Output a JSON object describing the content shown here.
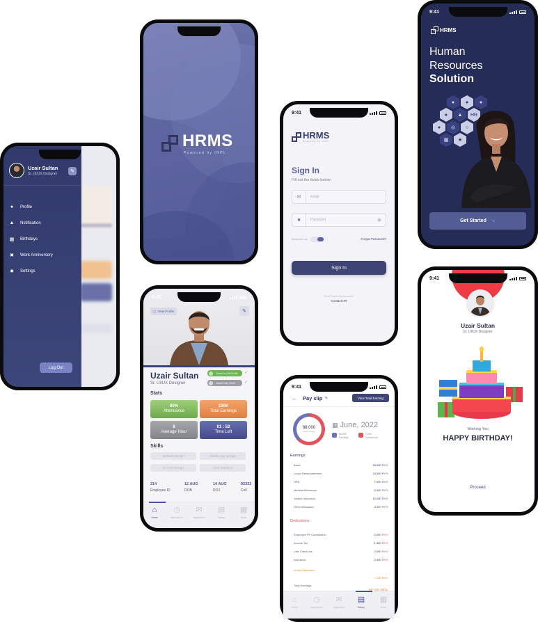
{
  "status_time": "9:41",
  "brand": {
    "name": "HRMS",
    "tagline": "Powered by INPL"
  },
  "user": {
    "name": "Uzair Sultan",
    "role": "Sr. UI/UX Designer"
  },
  "side_menu": {
    "items": [
      {
        "icon": "user-icon",
        "label": "Profile"
      },
      {
        "icon": "bell-icon",
        "label": "Notification"
      },
      {
        "icon": "calendar-icon",
        "label": "Birthdays"
      },
      {
        "icon": "anniversary-icon",
        "label": "Work Anniversery"
      },
      {
        "icon": "gear-icon",
        "label": "Settings"
      }
    ],
    "logout_label": "Log Out"
  },
  "signin": {
    "title": "Sign In",
    "subtitle": "Fill out the fields below:",
    "email_placeholder": "Email",
    "password_placeholder": "Password",
    "remember_label": "Remember me",
    "forgot_label": "Forgot Password?",
    "button_label": "Sign In",
    "no_account_text": "Don't Have An Account?",
    "contact_label": "Contact HR"
  },
  "profile": {
    "view_profile_label": "View Profile",
    "check_in": "Check In  |  09:00 AM",
    "check_out": "Check Out  |  06:00",
    "stats_heading": "Stats",
    "stats": [
      {
        "value": "80%",
        "label": "Attendance",
        "color": "#7fb85a"
      },
      {
        "value": "100K",
        "label": "Total Earnings",
        "color": "#e88a4c"
      },
      {
        "value": "8",
        "label": "Average Hour",
        "color": "#8e8e96"
      },
      {
        "value": "01 : 52",
        "label": "Time Left",
        "color": "#4d5596"
      }
    ],
    "skills_heading": "Skills",
    "skills": [
      "Website Design",
      "Mobile App Design",
      "UI / UX Design",
      "User Interface"
    ],
    "info": [
      {
        "value": "214",
        "label": "Employee ID"
      },
      {
        "value": "12 AUG",
        "label": "DOB"
      },
      {
        "value": "14 AUG",
        "label": "DOJ"
      },
      {
        "value": "92333",
        "label": "Cell"
      }
    ]
  },
  "tabs": [
    {
      "icon": "home-icon",
      "label": "Home"
    },
    {
      "icon": "clock-icon",
      "label": "Attendance"
    },
    {
      "icon": "mail-icon",
      "label": "Application"
    },
    {
      "icon": "document-icon",
      "label": "Salary"
    },
    {
      "icon": "grid-icon",
      "label": "More"
    }
  ],
  "payslip": {
    "title": "Pay slip",
    "view_total_label": "View Total Earning",
    "donut_value": "88,000",
    "donut_label": "Gross Salary",
    "date": "June, 2022",
    "legend": [
      {
        "value": "88,000",
        "label": "Earnings",
        "color": "#6b72b8"
      },
      {
        "value": "7,000",
        "label": "Deductions",
        "color": "#e2545d"
      }
    ],
    "earnings_heading": "Earnings",
    "earnings": [
      {
        "label": "Basic",
        "amount": "35,000",
        "currency": "PKR"
      },
      {
        "label": "Lunch Reimbursement",
        "amount": "23,000",
        "currency": "PKR"
      },
      {
        "label": "HRA",
        "amount": "7,000",
        "currency": "PKR"
      },
      {
        "label": "Medical Allowance",
        "amount": "5,000",
        "currency": "PKR"
      },
      {
        "label": "Jubilee Insurance",
        "amount": "10,000",
        "currency": "PKR"
      },
      {
        "label": "Other Allowance",
        "amount": "3,000",
        "currency": "PKR"
      }
    ],
    "deductions_heading": "Deductions",
    "deductions": [
      {
        "label": "Employee PF Contribution",
        "amount": "2,000",
        "currency": "PKR"
      },
      {
        "label": "Income Tax",
        "amount": "1,000",
        "currency": "PKR"
      },
      {
        "label": "Late Check Ins",
        "amount": "2,000",
        "currency": "PKR"
      },
      {
        "label": "Insurance",
        "amount": "2,000",
        "currency": "PKR"
      }
    ],
    "gross_deduction_label": "Gross Deduction",
    "gross_deduction_value": "7,000 PKR",
    "total_earnings_label": "Total Earnings",
    "total_earnings_value": "88,000 PKR"
  },
  "welcome": {
    "line1": "Human",
    "line2": "Resources",
    "line3": "Solution",
    "button_label": "Get Started"
  },
  "birthday": {
    "wishing": "Wishing You",
    "happy": "HAPPY BIRTHDAY!",
    "proceed": "Proceed"
  },
  "colors": {
    "primary": "#3e4473",
    "accent": "#5b62a8",
    "danger": "#e2545d"
  }
}
